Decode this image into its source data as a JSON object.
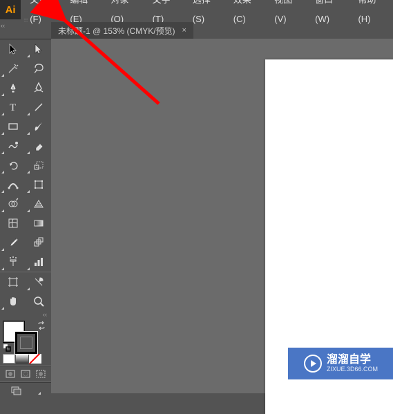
{
  "app": {
    "logo": "Ai"
  },
  "menubar": {
    "items": [
      {
        "label": "文件(F)"
      },
      {
        "label": "编辑(E)"
      },
      {
        "label": "对象(O)"
      },
      {
        "label": "文字(T)"
      },
      {
        "label": "选择(S)"
      },
      {
        "label": "效果(C)"
      },
      {
        "label": "视图(V)"
      },
      {
        "label": "窗口(W)"
      },
      {
        "label": "帮助(H)"
      }
    ]
  },
  "document_tab": {
    "title": "未标题-1 @ 153% (CMYK/预览)",
    "close": "×"
  },
  "tools": {
    "selection": "selection-tool",
    "direct_selection": "direct-selection-tool",
    "magic_wand": "magic-wand-tool",
    "lasso": "lasso-tool",
    "pen": "pen-tool",
    "curvature": "curvature-tool",
    "type": "type-tool",
    "line": "line-segment-tool",
    "rectangle": "rectangle-tool",
    "paintbrush": "paintbrush-tool",
    "shaper": "shaper-tool",
    "eraser": "eraser-tool",
    "rotate": "rotate-tool",
    "scale": "scale-tool",
    "width": "width-tool",
    "free_transform": "free-transform-tool",
    "shape_builder": "shape-builder-tool",
    "perspective": "perspective-grid-tool",
    "mesh": "mesh-tool",
    "gradient": "gradient-tool",
    "eyedropper": "eyedropper-tool",
    "blend": "blend-tool",
    "symbol_sprayer": "symbol-sprayer-tool",
    "column_graph": "column-graph-tool",
    "artboard": "artboard-tool",
    "slice": "slice-tool",
    "hand": "hand-tool",
    "zoom": "zoom-tool"
  },
  "color": {
    "fill": "#ffffff",
    "stroke": "#000000"
  },
  "watermark": {
    "title": "溜溜自学",
    "sub": "ZIXUE.3D66.COM"
  }
}
